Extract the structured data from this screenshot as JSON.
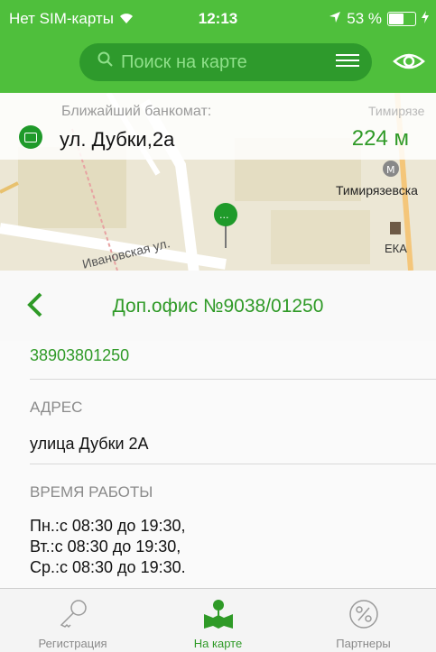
{
  "status_bar": {
    "carrier": "Нет SIM-карты",
    "time": "12:13",
    "battery_percent": "53 %",
    "battery_level": 0.53
  },
  "search": {
    "placeholder": "Поиск на карте"
  },
  "nearest_atm": {
    "label": "Ближайший банкомат:",
    "address": "ул. Дубки,2а",
    "distance": "224 м"
  },
  "map": {
    "street_label": "Ивановская ул.",
    "metro_label": "Тимирязевска",
    "place_label": "ЕКА",
    "top_right_label": "Тимирязе"
  },
  "office": {
    "title": "Доп.офис №9038/01250",
    "phone": "38903801250",
    "address_label": "АДРЕС",
    "address_value": "улица Дубки 2А",
    "hours_label": "ВРЕМЯ РАБОТЫ",
    "hours": [
      "Пн.:с 08:30 до 19:30,",
      "Вт.:с 08:30 до 19:30,",
      "Ср.:с 08:30 до 19:30."
    ]
  },
  "tabs": [
    {
      "label": "Регистрация",
      "icon": "key-icon",
      "active": false
    },
    {
      "label": "На карте",
      "icon": "map-pin-icon",
      "active": true
    },
    {
      "label": "Партнеры",
      "icon": "percent-icon",
      "active": false
    }
  ],
  "colors": {
    "accent": "#4fbf3c",
    "green_text": "#2f9a27",
    "search_bg": "#2e9a2c"
  }
}
